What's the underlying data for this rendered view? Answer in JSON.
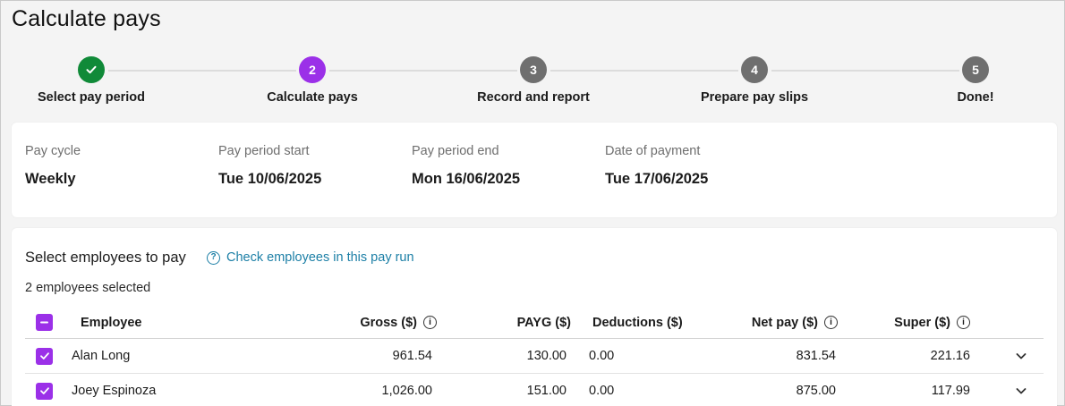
{
  "page": {
    "title": "Calculate pays"
  },
  "stepper": {
    "steps": [
      {
        "number": "1",
        "label": "Select pay period",
        "state": "done"
      },
      {
        "number": "2",
        "label": "Calculate pays",
        "state": "active"
      },
      {
        "number": "3",
        "label": "Record and report",
        "state": "todo"
      },
      {
        "number": "4",
        "label": "Prepare pay slips",
        "state": "todo"
      },
      {
        "number": "5",
        "label": "Done!",
        "state": "todo"
      }
    ]
  },
  "period": {
    "pay_cycle_label": "Pay cycle",
    "pay_cycle_value": "Weekly",
    "start_label": "Pay period start",
    "start_value": "Tue 10/06/2025",
    "end_label": "Pay period end",
    "end_value": "Mon 16/06/2025",
    "payment_label": "Date of payment",
    "payment_value": "Tue 17/06/2025"
  },
  "employees": {
    "heading": "Select employees to pay",
    "check_link": "Check employees in this pay run",
    "selected_count": "2 employees selected",
    "columns": {
      "employee": "Employee",
      "gross": "Gross ($)",
      "payg": "PAYG ($)",
      "deductions": "Deductions ($)",
      "net": "Net pay ($)",
      "super": "Super ($)"
    },
    "rows": [
      {
        "name": "Alan Long",
        "gross": "961.54",
        "payg": "130.00",
        "deductions": "0.00",
        "net": "831.54",
        "super": "221.16",
        "selected": true
      },
      {
        "name": "Joey Espinoza",
        "gross": "1,026.00",
        "payg": "151.00",
        "deductions": "0.00",
        "net": "875.00",
        "super": "117.99",
        "selected": true
      }
    ]
  },
  "colors": {
    "accent": "#9b30e8",
    "success": "#108a38",
    "pending_step": "#6f6f6f",
    "link": "#1c7fa6"
  },
  "icons": [
    "check-icon",
    "question-circle-icon",
    "info-icon",
    "minus-icon",
    "chevron-down-icon"
  ]
}
